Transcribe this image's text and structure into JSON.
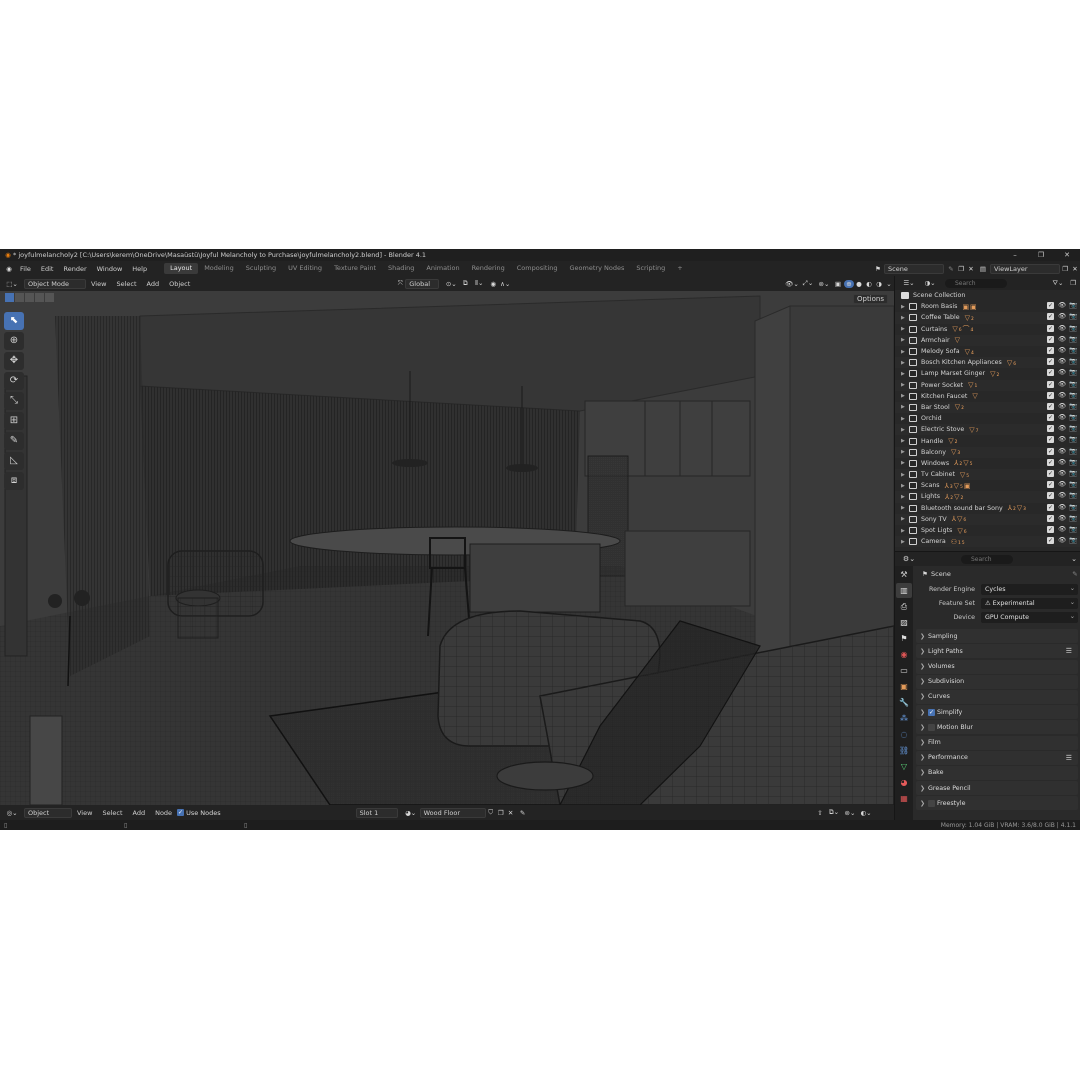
{
  "titlebar": {
    "title": "* joyfulmelancholy2 [C:\\Users\\kerem\\OneDrive\\Masaüstü\\Joyful Melancholy to Purchase\\joyfulmelancholy2.blend] - Blender 4.1",
    "minimize": "–",
    "maximize": "❐",
    "close": "✕"
  },
  "menu": [
    "File",
    "Edit",
    "Render",
    "Window",
    "Help"
  ],
  "workspaces": [
    "Layout",
    "Modeling",
    "Sculpting",
    "UV Editing",
    "Texture Paint",
    "Shading",
    "Animation",
    "Rendering",
    "Compositing",
    "Geometry Nodes",
    "Scripting"
  ],
  "add_workspace": "+",
  "scene_selector": "Scene",
  "viewlayer_selector": "ViewLayer",
  "viewport": {
    "mode": "Object Mode",
    "menus": [
      "View",
      "Select",
      "Add",
      "Object"
    ],
    "transform_orientation": "Global",
    "options_label": "Options"
  },
  "shader_bar": {
    "editor": "Object",
    "menus": [
      "View",
      "Select",
      "Add",
      "Node"
    ],
    "use_nodes_label": "Use Nodes",
    "slot": "Slot 1",
    "material": "Wood Floor"
  },
  "outliner": {
    "search_placeholder": "Search",
    "root": "Scene Collection",
    "items": [
      {
        "name": "Room Basis",
        "tags": "▣▣"
      },
      {
        "name": "Coffee Table",
        "tags": "▽₂"
      },
      {
        "name": "Curtains",
        "tags": "▽₆⌒₄"
      },
      {
        "name": "Armchair",
        "tags": "▽"
      },
      {
        "name": "Melody Sofa",
        "tags": "▽₄"
      },
      {
        "name": "Bosch Kitchen Appliances",
        "tags": "▽₆"
      },
      {
        "name": "Lamp Marset Ginger",
        "tags": "▽₂"
      },
      {
        "name": "Power Socket",
        "tags": "▽₁"
      },
      {
        "name": "Kitchen Faucet",
        "tags": "▽"
      },
      {
        "name": "Bar Stool",
        "tags": "▽₂"
      },
      {
        "name": "Orchid",
        "tags": ""
      },
      {
        "name": "Electric Stove",
        "tags": "▽₇"
      },
      {
        "name": "Handle",
        "tags": "▽₂"
      },
      {
        "name": "Balcony",
        "tags": "▽₃"
      },
      {
        "name": "Windows",
        "tags": "⅄₂▽₅"
      },
      {
        "name": "Tv Cabinet",
        "tags": "▽₅"
      },
      {
        "name": "Scans",
        "tags": "⅄₃▽₅▣"
      },
      {
        "name": "Lights",
        "tags": "⅄₂▽₂"
      },
      {
        "name": "Bluetooth sound bar Sony",
        "tags": "⅄₂▽₃"
      },
      {
        "name": "Sony TV",
        "tags": "⅄▽₆"
      },
      {
        "name": "Spot Ligts",
        "tags": "▽₆"
      },
      {
        "name": "Camera",
        "tags": "⚇₁₅"
      }
    ]
  },
  "properties": {
    "search_placeholder": "Search",
    "context": "Scene",
    "fields": [
      {
        "label": "Render Engine",
        "value": "Cycles"
      },
      {
        "label": "Feature Set",
        "value": "⚠ Experimental"
      },
      {
        "label": "Device",
        "value": "GPU Compute"
      }
    ],
    "panels": [
      {
        "label": "Sampling",
        "checkbox": null,
        "list": false
      },
      {
        "label": "Light Paths",
        "checkbox": null,
        "list": true
      },
      {
        "label": "Volumes",
        "checkbox": null,
        "list": false
      },
      {
        "label": "Subdivision",
        "checkbox": null,
        "list": false
      },
      {
        "label": "Curves",
        "checkbox": null,
        "list": false
      },
      {
        "label": "Simplify",
        "checkbox": true,
        "list": false
      },
      {
        "label": "Motion Blur",
        "checkbox": false,
        "list": false
      },
      {
        "label": "Film",
        "checkbox": null,
        "list": false
      },
      {
        "label": "Performance",
        "checkbox": null,
        "list": true
      },
      {
        "label": "Bake",
        "checkbox": null,
        "list": false
      },
      {
        "label": "Grease Pencil",
        "checkbox": null,
        "list": false
      },
      {
        "label": "Freestyle",
        "checkbox": false,
        "list": false
      }
    ]
  },
  "status": {
    "memory": "Memory: 1.04 GiB | VRAM: 3.6/8.0 GiB | 4.1.1"
  },
  "colors": {
    "accent": "#4772b3",
    "object_tag": "#e39b5a",
    "viewport_bg": "#3b3b3b"
  }
}
